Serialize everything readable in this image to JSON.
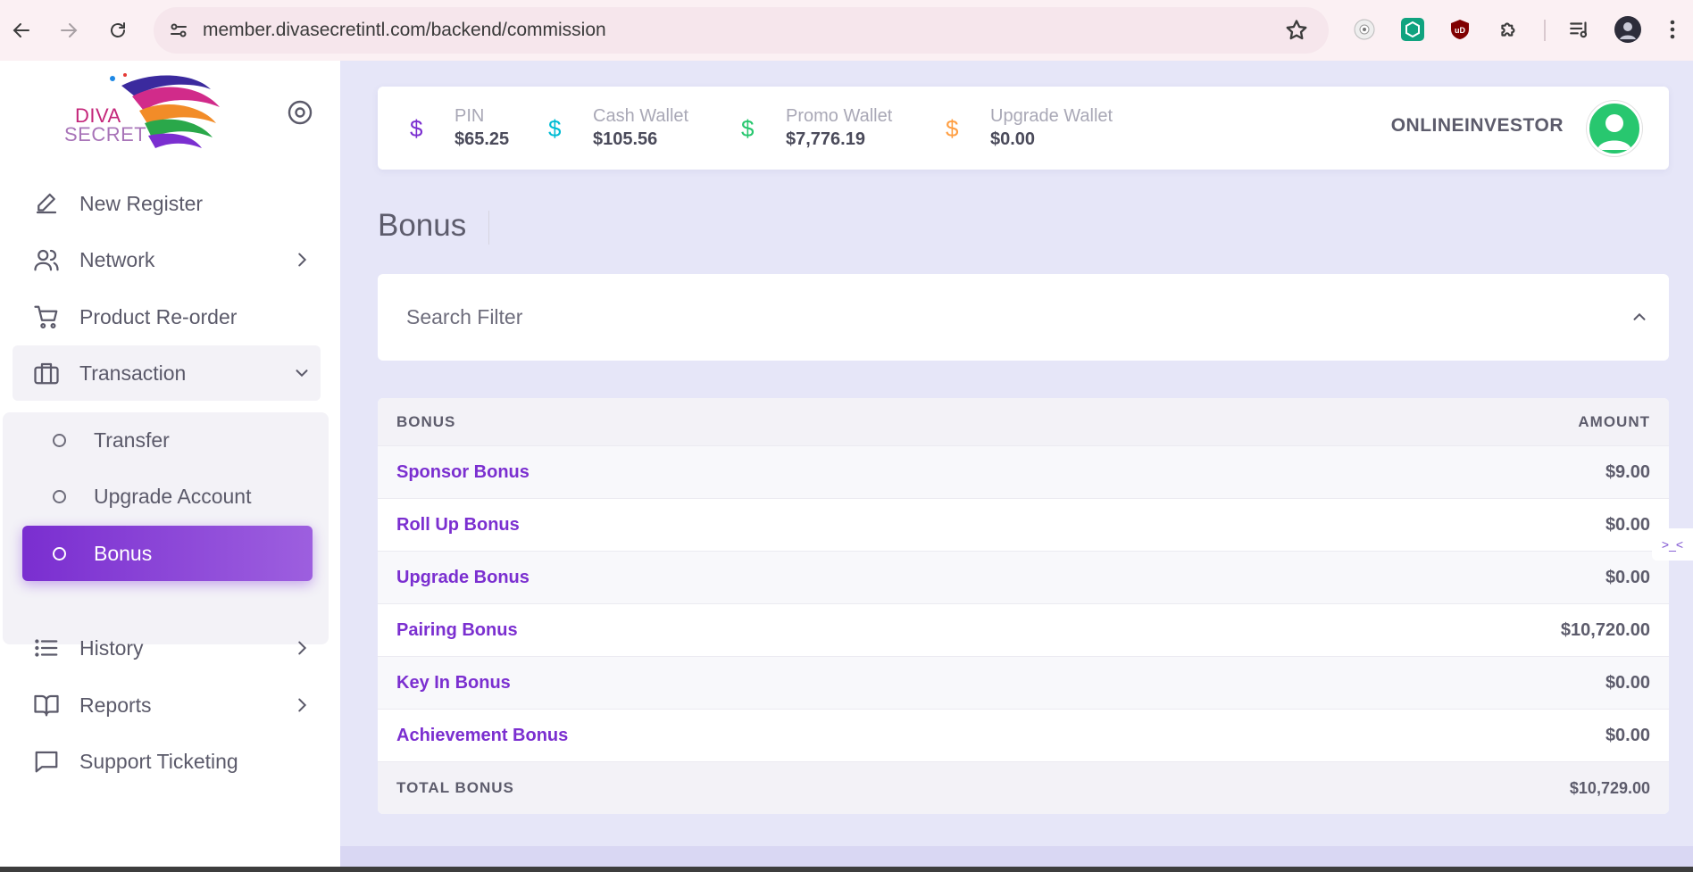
{
  "browser": {
    "url_host": "member.divasecretintl.com",
    "url_path": "/backend/commission"
  },
  "sidebar": {
    "logo_line1": "DIVA",
    "logo_line2": "SECRET",
    "items": [
      {
        "label": "New Register",
        "icon": "edit-icon"
      },
      {
        "label": "Network",
        "icon": "users-icon"
      },
      {
        "label": "Product Re-order",
        "icon": "cart-icon"
      },
      {
        "label": "Transaction",
        "icon": "briefcase-icon"
      },
      {
        "label": "History",
        "icon": "list-icon"
      },
      {
        "label": "Reports",
        "icon": "book-icon"
      },
      {
        "label": "Support Ticketing",
        "icon": "message-icon"
      }
    ],
    "submenu": [
      {
        "label": "Transfer"
      },
      {
        "label": "Upgrade Account"
      },
      {
        "label": "Bonus"
      }
    ]
  },
  "wallets": [
    {
      "symbol": "$",
      "label": "PIN",
      "value": "$65.25",
      "color": "#7b2fd0"
    },
    {
      "symbol": "$",
      "label": "Cash Wallet",
      "value": "$105.56",
      "color": "#00bcd4"
    },
    {
      "symbol": "$",
      "label": "Promo Wallet",
      "value": "$7,776.19",
      "color": "#28c76f"
    },
    {
      "symbol": "$",
      "label": "Upgrade Wallet",
      "value": "$0.00",
      "color": "#ff9f43"
    }
  ],
  "user": {
    "name": "ONLINEINVESTOR"
  },
  "page": {
    "title": "Bonus"
  },
  "filter": {
    "title": "Search Filter"
  },
  "table": {
    "headers": {
      "bonus": "BONUS",
      "amount": "AMOUNT"
    },
    "rows": [
      {
        "name": "Sponsor Bonus",
        "amount": "$9.00"
      },
      {
        "name": "Roll Up Bonus",
        "amount": "$0.00"
      },
      {
        "name": "Upgrade Bonus",
        "amount": "$0.00"
      },
      {
        "name": "Pairing Bonus",
        "amount": "$10,720.00"
      },
      {
        "name": "Key In Bonus",
        "amount": "$0.00"
      },
      {
        "name": "Achievement Bonus",
        "amount": "$0.00"
      }
    ],
    "total": {
      "label": "TOTAL BONUS",
      "amount": "$10,729.00"
    }
  },
  "colors": {
    "accent": "#7b2fd0",
    "success": "#28c76f"
  }
}
